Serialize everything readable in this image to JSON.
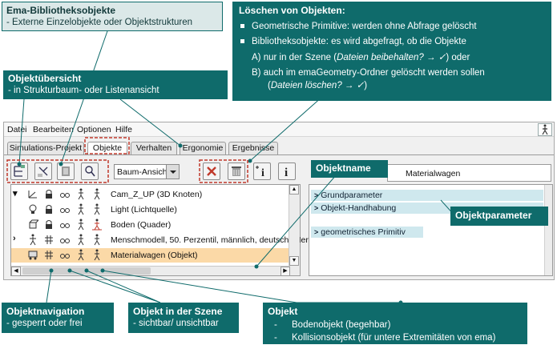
{
  "callouts": {
    "library": {
      "title": "Ema-Bibliotheksobjekte",
      "subtitle": "- Externe Einzelobjekte oder Objektstrukturen"
    },
    "delete": {
      "title": "Löschen von Objekten:",
      "bullets": [
        "Geometrische Primitive: werden ohne Abfrage gelöscht",
        "Bibliotheksobjekte: es wird abgefragt, ob die Objekte"
      ],
      "a": "A)  nur in der Szene (",
      "a_italic": "Dateien beibehalten? → ✓",
      "a_end": ") oder",
      "b": "B)  auch im emaGeometry-Ordner gelöscht werden sollen",
      "b2": "(",
      "b2_italic": "Dateien löschen? → ✓",
      "b2_end": ")"
    },
    "overview": {
      "title": "Objektübersicht",
      "subtitle": "- in Strukturbaum- oder Listenansicht"
    },
    "objname": {
      "title": "Objektname"
    },
    "objparam": {
      "title": "Objektparameter"
    },
    "navigation": {
      "title": "Objektnavigation",
      "subtitle": "- gesperrt oder frei"
    },
    "scene": {
      "title": "Objekt in der Szene",
      "subtitle": "- sichtbar/ unsichtbar"
    },
    "object": {
      "title": "Objekt",
      "items": [
        "Bodenobjekt (begehbar)",
        "Kollisionsobjekt (für untere Extremitäten von ema)"
      ]
    }
  },
  "app": {
    "menu": [
      "Datei",
      "Bearbeiten",
      "Optionen",
      "Hilfe"
    ],
    "tabs": [
      "Simulations-Projekt",
      "Objekte",
      "Verhalten",
      "Ergonomie",
      "Ergebnisse"
    ],
    "active_tab": "Objekte",
    "view_select": "Baum-Ansicht",
    "object_name": "Materialwagen",
    "tree_rows": [
      "Cam_Z_UP (3D Knoten)",
      "Light (Lichtquelle)",
      "Boden (Quader)",
      "Menschmodell, 50. Perzentil, männlich, deutsch (Mer",
      "Materialwagen (Objekt)"
    ],
    "params": [
      "Grundparameter",
      "Objekt-Handhabung",
      "geometrisches Primitiv"
    ],
    "colors": {
      "callout": "#0f6b6b",
      "selection": "#fbd9a7",
      "highlight_frame": "#c0392b"
    }
  }
}
